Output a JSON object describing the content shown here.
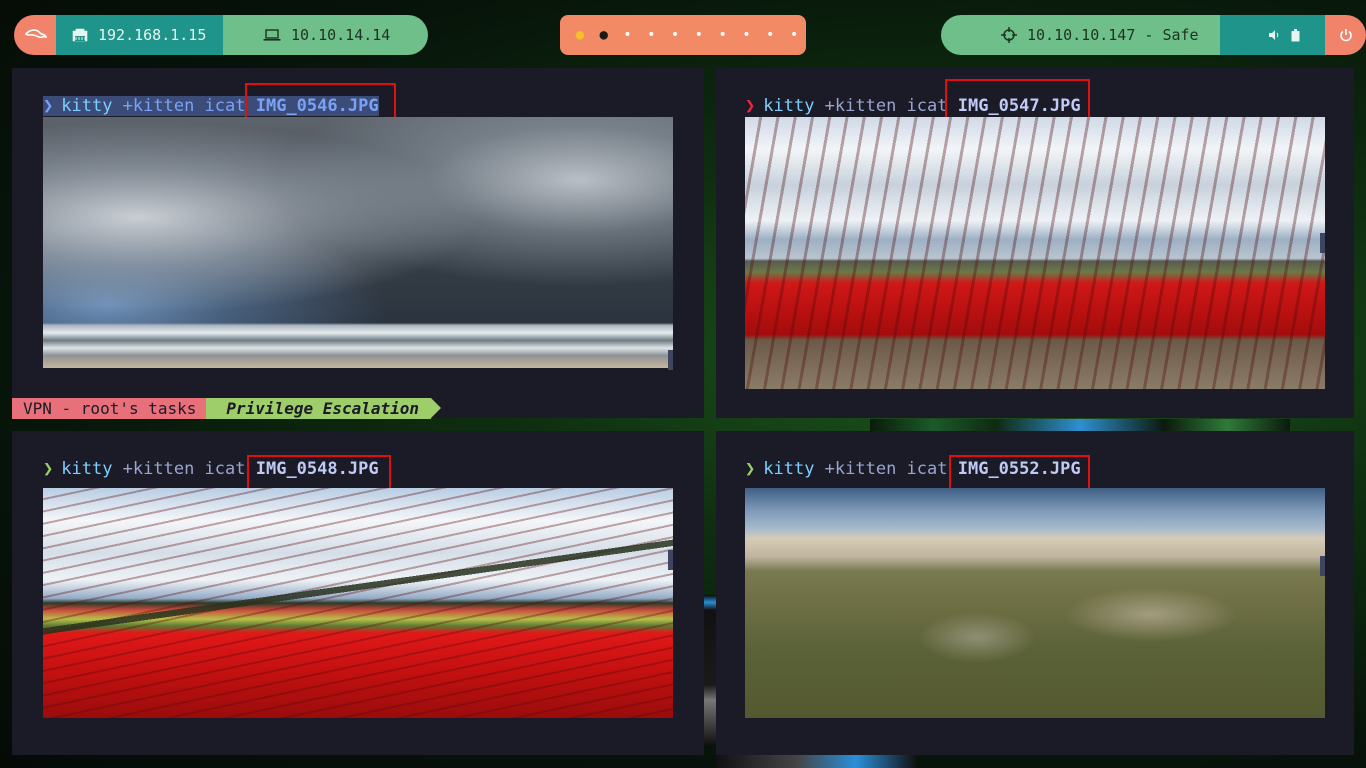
{
  "topbar": {
    "ip_local": "192.168.1.15",
    "ip_vpn": "10.10.14.14",
    "target": "10.10.10.147 - Safe",
    "workspaces": [
      {
        "glyph": "●",
        "state": "urgent"
      },
      {
        "glyph": "●",
        "state": "active"
      },
      {
        "glyph": "•",
        "state": "normal"
      },
      {
        "glyph": "•",
        "state": "normal"
      },
      {
        "glyph": "•",
        "state": "normal"
      },
      {
        "glyph": "•",
        "state": "normal"
      },
      {
        "glyph": "•",
        "state": "normal"
      },
      {
        "glyph": "•",
        "state": "normal"
      },
      {
        "glyph": "•",
        "state": "normal"
      },
      {
        "glyph": "•",
        "state": "normal"
      }
    ],
    "icons": {
      "launcher": "kali-dragon-icon",
      "network": "ethernet-icon",
      "vpn": "laptop-icon",
      "target": "crosshair-icon",
      "volume": "volume-icon",
      "battery": "battery-icon",
      "power": "power-icon"
    }
  },
  "panes": [
    {
      "prompt_arrow": "❯",
      "cmd": "kitty",
      "args": " +kitten icat ",
      "file": "IMG_0546.JPG"
    },
    {
      "prompt_arrow": "❯",
      "cmd": "kitty",
      "args": " +kitten icat ",
      "file": "IMG_0547.JPG"
    },
    {
      "prompt_arrow": "❯",
      "cmd": "kitty",
      "args": " +kitten icat ",
      "file": "IMG_0548.JPG"
    },
    {
      "prompt_arrow": "❯",
      "cmd": "kitty",
      "args": " +kitten icat ",
      "file": "IMG_0552.JPG"
    }
  ],
  "tmux": {
    "session": "VPN - root's tasks",
    "window": "Privilege Escalation"
  },
  "colors": {
    "pane_bg": "#1a1b26",
    "highlight_box": "#e01010",
    "accent_salmon": "#f0836a",
    "accent_teal": "#1e948a",
    "accent_green": "#6fbf8a"
  }
}
